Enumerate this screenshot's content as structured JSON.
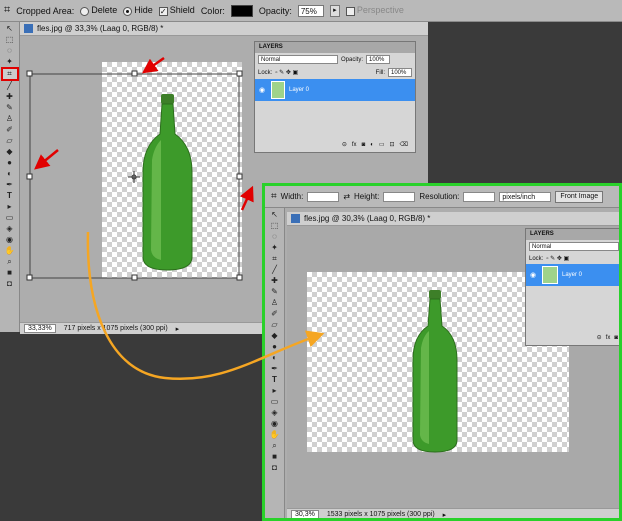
{
  "options_bar": {
    "cropped_area_label": "Cropped Area:",
    "delete_label": "Delete",
    "hide_label": "Hide",
    "shield_label": "Shield",
    "color_label": "Color:",
    "opacity_label": "Opacity:",
    "opacity_value": "75%",
    "perspective_label": "Perspective"
  },
  "document": {
    "title": "fles.jpg @ 33,3% (Laag 0, RGB/8) *",
    "zoom": "33,33%",
    "status": "717 pixels x 1075 pixels (300 ppi)"
  },
  "layers_panel": {
    "tab": "LAYERS",
    "blend_mode": "Normal",
    "opacity_label": "Opacity:",
    "opacity_value": "100%",
    "lock_label": "Lock:",
    "fill_label": "Fill:",
    "fill_value": "100%",
    "layer_name": "Layer 0"
  },
  "inset": {
    "options": {
      "width_label": "Width:",
      "height_label": "Height:",
      "resolution_label": "Resolution:",
      "units": "pixels/inch",
      "front_image_label": "Front Image"
    },
    "document": {
      "title": "fles.jpg @ 30,3% (Laag 0, RGB/8) *",
      "zoom": "30,3%",
      "status": "1533 pixels x 1075 pixels (300 ppi)"
    },
    "layers_panel": {
      "tab": "LAYERS",
      "blend_mode": "Normal",
      "lock_label": "Lock:",
      "layer_name": "Layer 0"
    }
  },
  "colors": {
    "highlight_border": "#29d12a",
    "tool_highlight": "#e10000",
    "arrow_red": "#e10000",
    "arrow_orange": "#f5a623",
    "layer_selected": "#3b8ff0",
    "bottle_green": "#3d9a2a"
  }
}
